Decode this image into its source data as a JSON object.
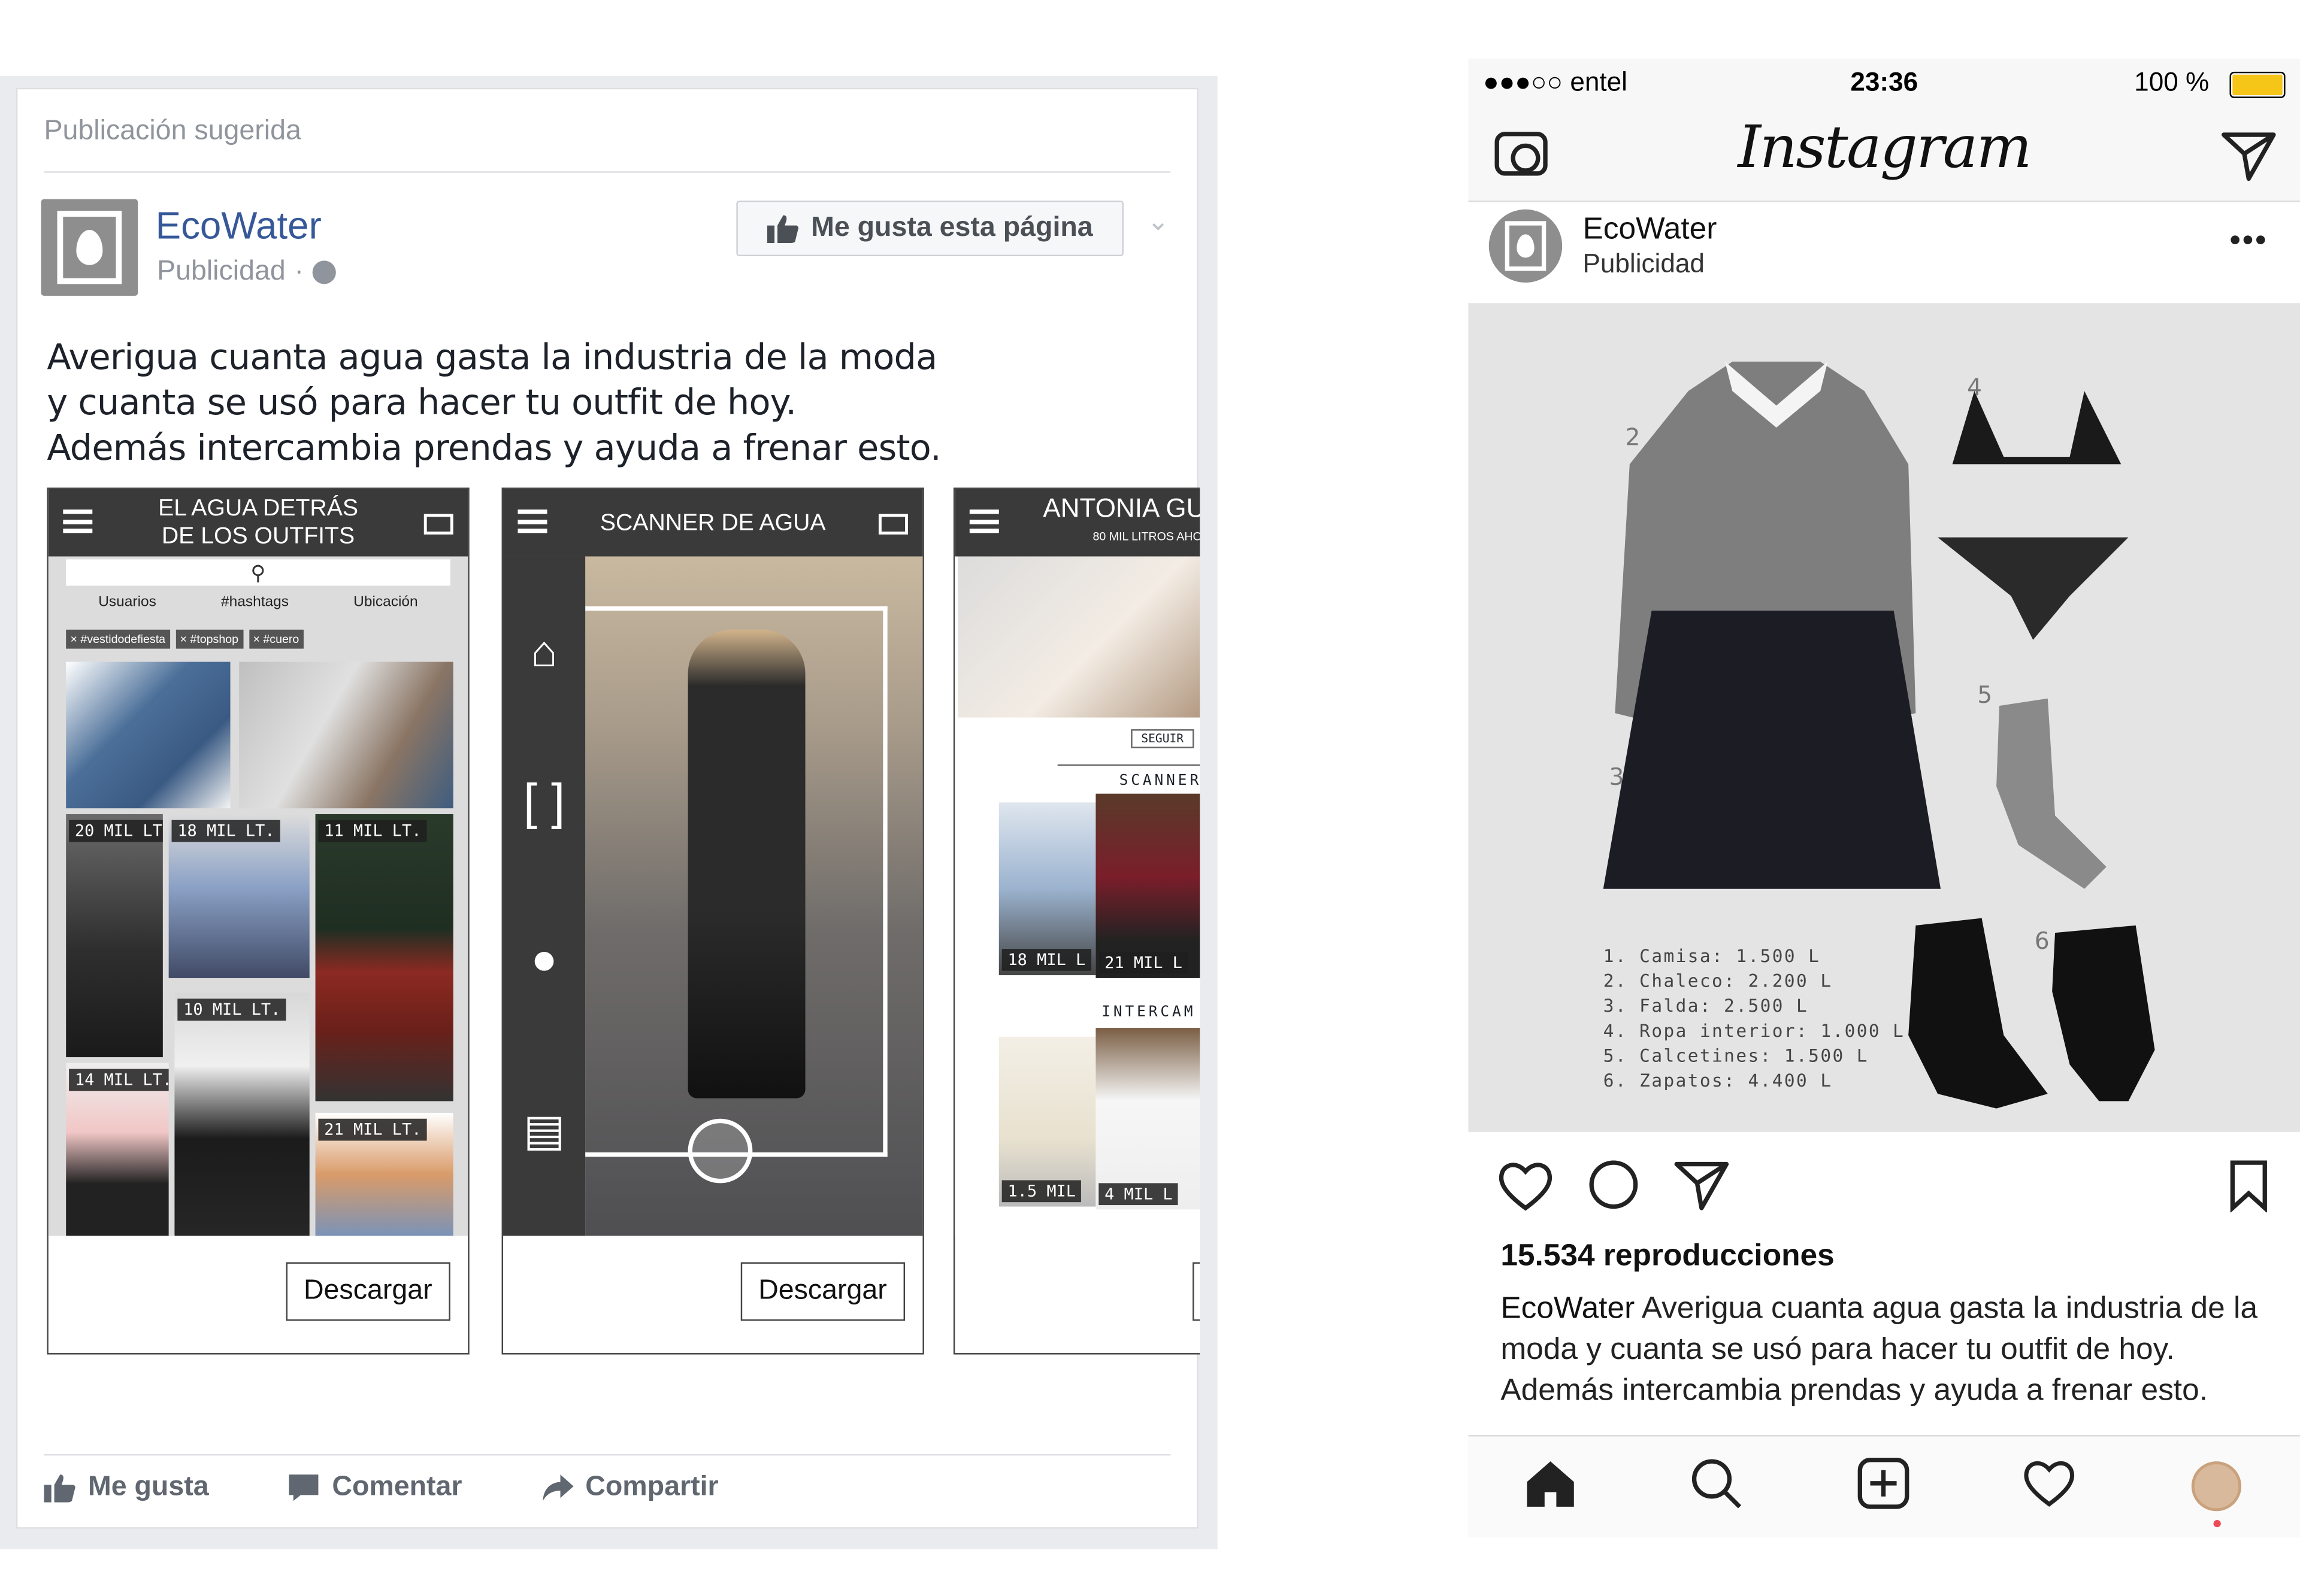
{
  "facebook": {
    "suggested_label": "Publicación sugerida",
    "page_name": "EcoWater",
    "sponsored_label": "Publicidad",
    "sponsored_separator": "·",
    "like_page_button": "Me gusta esta página",
    "post_text": [
      "Averigua cuanta agua gasta la industria de la moda",
      "y cuanta se usó para hacer tu outfit de hoy.",
      "Además intercambia prendas y ayuda a frenar esto."
    ],
    "carousel": [
      {
        "title_line1": "EL AGUA DETRÁS",
        "title_line2": "DE LOS OUTFITS",
        "tabs": [
          "Usuarios",
          "#hashtags",
          "Ubicación"
        ],
        "chips": [
          "× #vestidodefiesta",
          "× #topshop",
          "× #cuero"
        ],
        "tile_labels": [
          "20 MIL LT.",
          "18 MIL LT.",
          "11 MIL LT.",
          "10 MIL LT.",
          "14 MIL LT.",
          "21 MIL LT."
        ],
        "download_label": "Descargar"
      },
      {
        "title_line1": "SCANNER DE AGUA",
        "title_line2": "",
        "download_label": "Descargar"
      },
      {
        "title_line1": "ANTONIA GU",
        "subtitle": "80 MIL LITROS AHOR",
        "follow_label": "SEGUIR",
        "section1": "SCANNER",
        "section2": "INTERCAM",
        "tile_labels": [
          "18 MIL L",
          "21 MIL L",
          "1.5 MIL",
          "4 MIL L"
        ],
        "download_label": ""
      }
    ],
    "actions": {
      "like": "Me gusta",
      "comment": "Comentar",
      "share": "Compartir"
    },
    "colors": {
      "link": "#365899",
      "meta": "#90949c"
    }
  },
  "instagram": {
    "status": {
      "carrier": "●●●○○ entel",
      "time": "23:36",
      "battery_text": "100 %",
      "battery_level": 1.0
    },
    "logo": "Instagram",
    "account": "EcoWater",
    "account_sub": "Publicidad",
    "more": "•••",
    "image_numbers": [
      "2",
      "3",
      "4",
      "5",
      "6"
    ],
    "legend": [
      "1. Camisa: 1.500 L",
      "2. Chaleco: 2.200 L",
      "3. Falda: 2.500 L",
      "4. Ropa interior: 1.000 L",
      "5. Calcetines: 1.500 L",
      "6. Zapatos: 4.400 L"
    ],
    "views": "15.534 reproducciones",
    "caption_user": "EcoWater",
    "caption_text": "Averigua cuanta agua gasta la industria de la moda y cuanta se usó para hacer tu outfit de hoy. Además intercambia prendas y ayuda a frenar esto."
  }
}
